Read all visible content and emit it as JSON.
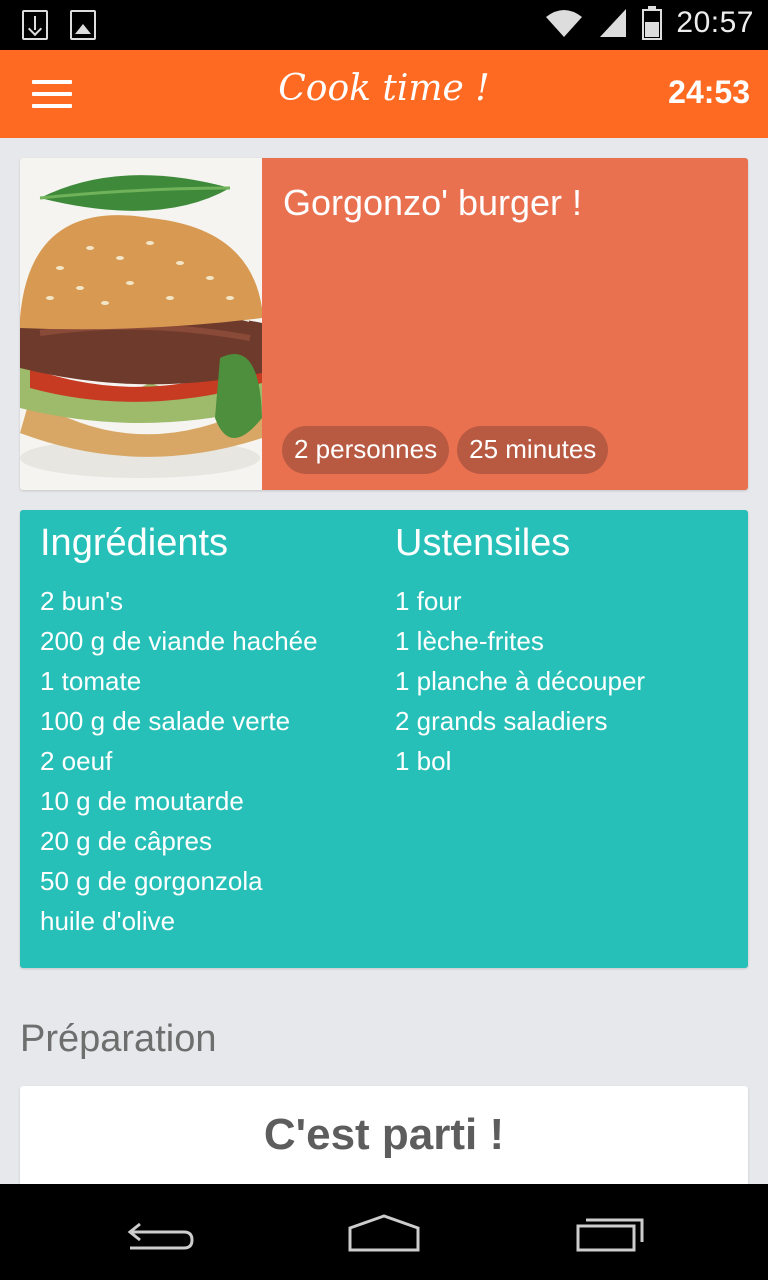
{
  "status_bar": {
    "time": "20:57",
    "icons": [
      "download-icon",
      "image-icon",
      "wifi-icon",
      "signal-icon",
      "battery-icon"
    ]
  },
  "app_bar": {
    "title": "Cook time !",
    "timer": "24:53",
    "menu_icon": "hamburger-menu-icon"
  },
  "recipe": {
    "name": "Gorgonzo' burger !",
    "servings": "2 personnes",
    "duration": "25 minutes"
  },
  "ingredients": {
    "title": "Ingrédients",
    "items": [
      "2 bun's",
      "200 g de viande hachée",
      "1 tomate",
      "100 g de salade verte",
      "2 oeuf",
      "10 g de moutarde",
      "20 g de câpres",
      "50 g de gorgonzola",
      "huile d'olive"
    ]
  },
  "utensils": {
    "title": "Ustensiles",
    "items": [
      "1 four",
      "1 lèche-frites",
      "1 planche à découper",
      "2 grands saladiers",
      "1 bol"
    ]
  },
  "preparation": {
    "title": "Préparation",
    "start_label": "C'est parti !"
  },
  "colors": {
    "app_bar": "#ff6a22",
    "recipe_card": "#ea7150",
    "ingredients_card": "#26c0b8",
    "background": "#e7e8ec"
  },
  "nav_bar": {
    "icons": [
      "back-icon",
      "home-icon",
      "recents-icon"
    ]
  }
}
